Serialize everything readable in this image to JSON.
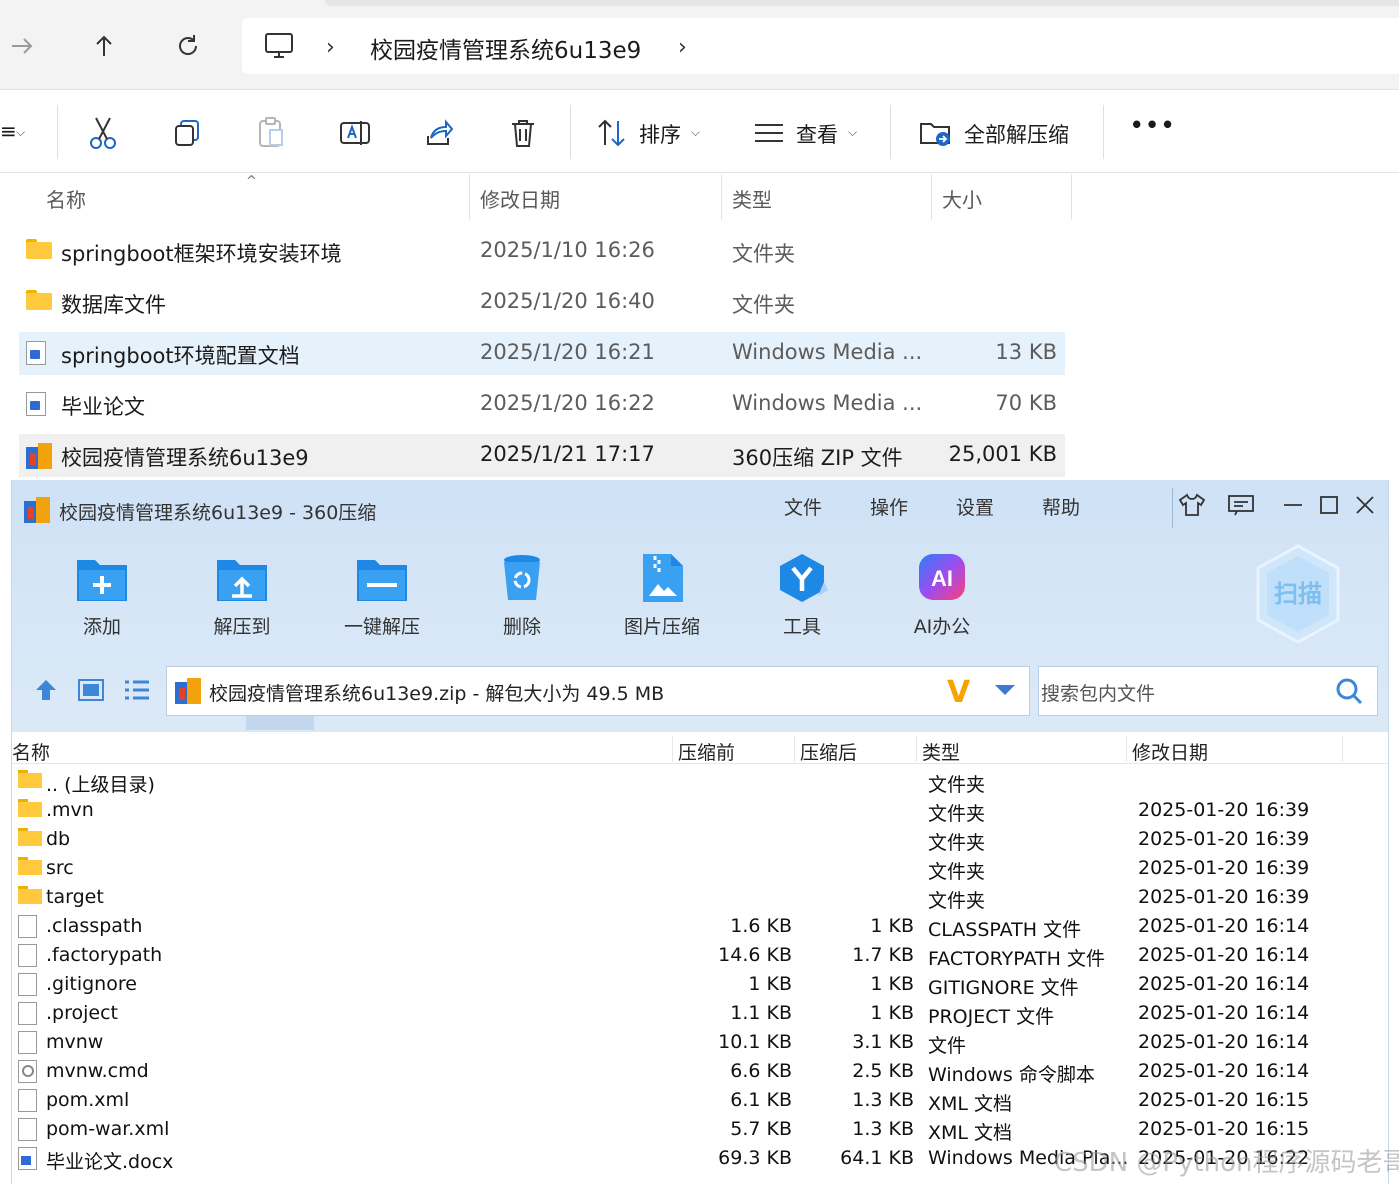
{
  "explorer": {
    "breadcrumb": "校园疫情管理系统6u13e9",
    "commands": {
      "sort_label": "排序",
      "view_label": "查看",
      "extract_all_label": "全部解压缩",
      "more_label": "•••"
    },
    "columns": [
      "名称",
      "修改日期",
      "类型",
      "大小"
    ],
    "rows": [
      {
        "name": "springboot框架环境安装环境",
        "date": "2025/1/10 16:26",
        "type": "文件夹",
        "size": "",
        "icon": "folder-icon"
      },
      {
        "name": "数据库文件",
        "date": "2025/1/20 16:40",
        "type": "文件夹",
        "size": "",
        "icon": "folder-icon"
      },
      {
        "name": "springboot环境配置文档",
        "date": "2025/1/20 16:21",
        "type": "Windows Media ...",
        "size": "13 KB",
        "icon": "document-icon"
      },
      {
        "name": "毕业论文",
        "date": "2025/1/20 16:22",
        "type": "Windows Media ...",
        "size": "70 KB",
        "icon": "document-icon"
      },
      {
        "name": "校园疫情管理系统6u13e9",
        "date": "2025/1/21 17:17",
        "type": "360压缩 ZIP 文件",
        "size": "25,001 KB",
        "icon": "zip-icon"
      }
    ]
  },
  "zip": {
    "title": "校园疫情管理系统6u13e9 - 360压缩",
    "menu": [
      "文件",
      "操作",
      "设置",
      "帮助"
    ],
    "tools": [
      "添加",
      "解压到",
      "一键解压",
      "删除",
      "图片压缩",
      "工具",
      "AI办公"
    ],
    "scan_label": "扫描",
    "ai_badge": "AI",
    "path_text": "校园疫情管理系统6u13e9.zip - 解包大小为 49.5 MB",
    "search_placeholder": "搜索包内文件",
    "columns": [
      "名称",
      "压缩前",
      "压缩后",
      "类型",
      "修改日期"
    ],
    "rows": [
      {
        "name": ".. (上级目录)",
        "before": "",
        "after": "",
        "type": "文件夹",
        "date": "",
        "icon": "folder-icon"
      },
      {
        "name": ".mvn",
        "before": "",
        "after": "",
        "type": "文件夹",
        "date": "2025-01-20 16:39",
        "icon": "folder-icon"
      },
      {
        "name": "db",
        "before": "",
        "after": "",
        "type": "文件夹",
        "date": "2025-01-20 16:39",
        "icon": "folder-icon"
      },
      {
        "name": "src",
        "before": "",
        "after": "",
        "type": "文件夹",
        "date": "2025-01-20 16:39",
        "icon": "folder-icon"
      },
      {
        "name": "target",
        "before": "",
        "after": "",
        "type": "文件夹",
        "date": "2025-01-20 16:39",
        "icon": "folder-icon"
      },
      {
        "name": ".classpath",
        "before": "1.6 KB",
        "after": "1 KB",
        "type": "CLASSPATH 文件",
        "date": "2025-01-20 16:14",
        "icon": "file-icon"
      },
      {
        "name": ".factorypath",
        "before": "14.6 KB",
        "after": "1.7 KB",
        "type": "FACTORYPATH 文件",
        "date": "2025-01-20 16:14",
        "icon": "file-icon"
      },
      {
        "name": ".gitignore",
        "before": "1 KB",
        "after": "1 KB",
        "type": "GITIGNORE 文件",
        "date": "2025-01-20 16:14",
        "icon": "file-icon"
      },
      {
        "name": ".project",
        "before": "1.1 KB",
        "after": "1 KB",
        "type": "PROJECT 文件",
        "date": "2025-01-20 16:14",
        "icon": "file-icon"
      },
      {
        "name": "mvnw",
        "before": "10.1 KB",
        "after": "3.1 KB",
        "type": "文件",
        "date": "2025-01-20 16:14",
        "icon": "file-icon"
      },
      {
        "name": "mvnw.cmd",
        "before": "6.6 KB",
        "after": "2.5 KB",
        "type": "Windows 命令脚本",
        "date": "2025-01-20 16:14",
        "icon": "cmd-file-icon"
      },
      {
        "name": "pom.xml",
        "before": "6.1 KB",
        "after": "1.3 KB",
        "type": "XML 文档",
        "date": "2025-01-20 16:15",
        "icon": "file-icon"
      },
      {
        "name": "pom-war.xml",
        "before": "5.7 KB",
        "after": "1.3 KB",
        "type": "XML 文档",
        "date": "2025-01-20 16:15",
        "icon": "file-icon"
      },
      {
        "name": "毕业论文.docx",
        "before": "69.3 KB",
        "after": "64.1 KB",
        "type": "Windows Media Pla...",
        "date": "2025-01-20 16:22",
        "icon": "docx-file-icon"
      }
    ]
  },
  "watermark": "CSDN @Python程序源码老哥",
  "colors": {
    "selection": "#e5f1fb",
    "zip_header": "#d3e5f6",
    "folder": "#ffc83d",
    "accent_blue": "#1e88e5"
  }
}
